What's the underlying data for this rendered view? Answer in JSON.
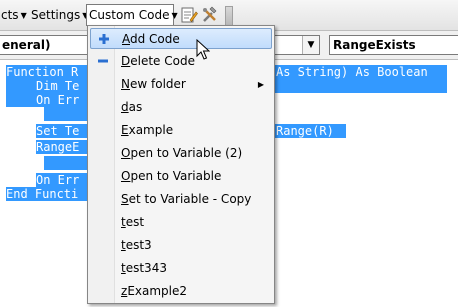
{
  "toolbar": {
    "items": [
      {
        "label": "cts"
      },
      {
        "label": "Settings"
      },
      {
        "label": "Custom Code"
      }
    ],
    "icons": [
      "edit-page-icon",
      "tools-icon"
    ]
  },
  "combos": {
    "left": "eneral)",
    "right": "RangeExists"
  },
  "code": {
    "lines": [
      "Function R",
      "Dim Te",
      "On Err",
      "",
      "Set Te",
      "RangeE",
      "",
      "On Err",
      "End Functi",
      "As String) As Boolean",
      "Range(R)"
    ]
  },
  "menu": {
    "items": [
      {
        "label": "Add Code",
        "underline": "A",
        "rest": "dd Code",
        "icon": "plus-icon"
      },
      {
        "label": "Delete Code",
        "underline": "D",
        "rest": "elete Code",
        "icon": "minus-icon"
      },
      {
        "label": "New folder",
        "underline": "N",
        "rest": "ew folder",
        "submenu": true
      },
      {
        "label": "das",
        "underline": "d",
        "rest": "as"
      },
      {
        "label": "Example",
        "underline": "E",
        "rest": "xample"
      },
      {
        "label": "Open to Variable (2)",
        "underline": "O",
        "rest": "pen to Variable (2)"
      },
      {
        "label": "Open to Variable",
        "underline": "O",
        "rest": "pen to Variable"
      },
      {
        "label": "Set to Variable - Copy",
        "underline": "S",
        "rest": "et to Variable - Copy"
      },
      {
        "label": "test",
        "underline": "t",
        "rest": "est"
      },
      {
        "label": "test3",
        "underline": "t",
        "rest": "est3"
      },
      {
        "label": "test343",
        "underline": "t",
        "rest": "est343"
      },
      {
        "label": "zExample2",
        "underline": "z",
        "rest": "Example2"
      }
    ],
    "hovered": "Add Code"
  },
  "colors": {
    "selection": "#3399ff",
    "menu_hover": "#c1dcfc",
    "plus_icon": "#2a6fd1"
  }
}
